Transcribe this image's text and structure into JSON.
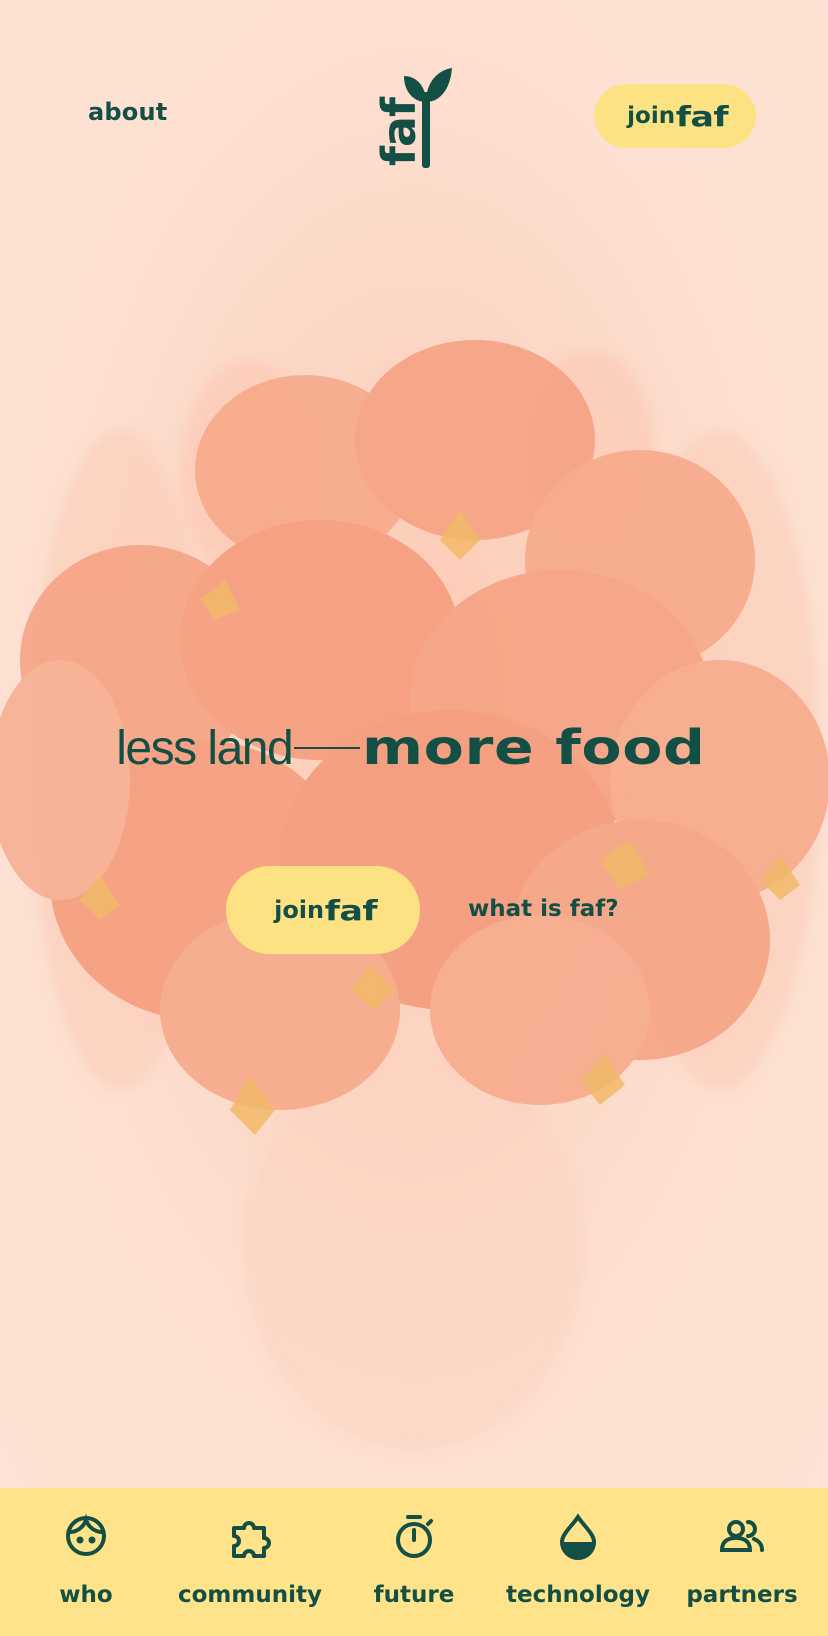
{
  "colors": {
    "background": "#fde3d5",
    "accent": "#fde284",
    "nav_background": "#fee38a",
    "text": "#134f44",
    "photo": "#f7a98a"
  },
  "header": {
    "about_label": "about",
    "logo_text": "faf",
    "join_label": "join",
    "join_brand": "faf"
  },
  "hero": {
    "headline_light": "less land",
    "headline_bold": "more food",
    "join_label": "join",
    "join_brand": "faf",
    "what_label": "what is faf?"
  },
  "bottom_nav": {
    "items": [
      {
        "label": "who",
        "icon": "face-icon"
      },
      {
        "label": "community",
        "icon": "puzzle-icon"
      },
      {
        "label": "future",
        "icon": "stopwatch-icon"
      },
      {
        "label": "technology",
        "icon": "drop-icon"
      },
      {
        "label": "partners",
        "icon": "people-icon"
      }
    ]
  }
}
